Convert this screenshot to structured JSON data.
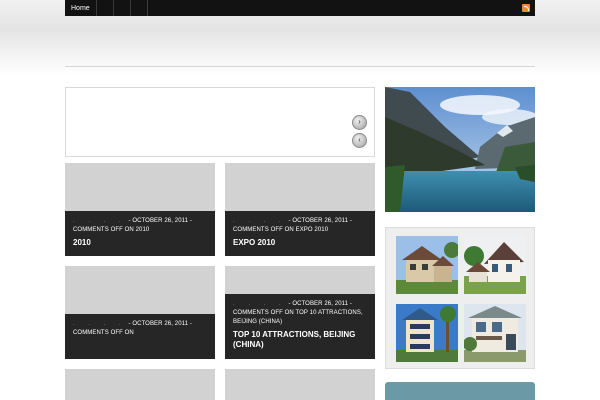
{
  "nav": {
    "items": [
      "Home",
      "",
      "",
      ""
    ],
    "rss_icon": "rss-icon"
  },
  "slider": {
    "next_icon": "chevron-right-icon",
    "prev_icon": "chevron-left-icon",
    "next_glyph": "›",
    "prev_glyph": "‹"
  },
  "posts": [
    {
      "date": "- OCTOBER 26, 2011 -",
      "comments": "COMMENTS OFF ON 2010",
      "title": "2010"
    },
    {
      "date": "- OCTOBER 26, 2011 -",
      "comments": "COMMENTS OFF ON EXPO 2010",
      "title": "EXPO 2010"
    },
    {
      "date": "- OCTOBER 26, 2011 -",
      "comments": "COMMENTS OFF ON",
      "title": ""
    },
    {
      "date": "- OCTOBER 26, 2011 -",
      "comments": "COMMENTS OFF ON TOP 10 ATTRACTIONS, BEIJING (CHINA)",
      "title": "TOP 10 ATTRACTIONS, BEIJING (CHINA)"
    }
  ],
  "meta_dots": ". . . .",
  "colors": {
    "topbar": "#121212",
    "meta_bg": "#262626",
    "thumb_placeholder": "#d2d2d2",
    "widget_accent": "#6b9aa6",
    "rss": "#f08a24"
  }
}
